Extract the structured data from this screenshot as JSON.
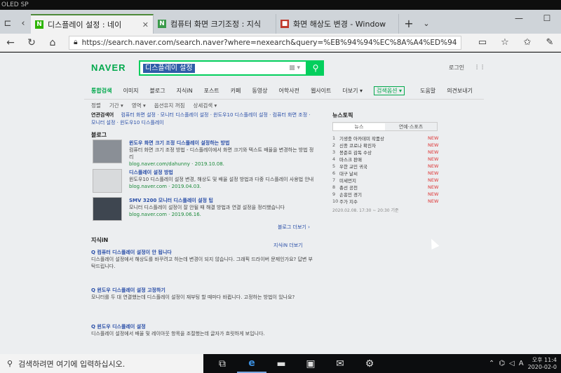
{
  "device_label": "OLED SP",
  "tabs": [
    {
      "title": "디스플레이 설정 : 네이",
      "icon": "N"
    },
    {
      "title": "컴퓨터 화면 크기조정 : 지식",
      "icon": "N"
    },
    {
      "title": "화면 해상도 변경 - Window",
      "icon": "■"
    }
  ],
  "address": "https://search.naver.com/search.naver?where=nexearch&query=%EB%94%94%EC%8A%A4%ED%94",
  "naver": {
    "logo": "NAVER",
    "query": "디스플레이 설정",
    "keyboard": "▩ ▾",
    "header_links": [
      "로그인",
      "⋮⋮"
    ],
    "categories": [
      "통합검색",
      "이미지",
      "블로그",
      "지식iN",
      "포스트",
      "카페",
      "동영상",
      "어학사전",
      "웹사이트",
      "더보기 ▾"
    ],
    "badge": "검색옵션 ▾",
    "right_links": [
      "도움말",
      "의견보내기"
    ],
    "options": [
      "정렬",
      "기간 ▾",
      "영역 ▾",
      "옵션유지 꺼짐",
      "상세검색 ▾"
    ]
  },
  "related": {
    "label": "연관검색어",
    "items": "컴퓨터 화면 설정 · 모니터 디스플레이 설정 · 윈도우10 디스플레이 설정 · 컴퓨터 화면 조정 · 모니터 설정 · 윈도우10 디스플레이"
  },
  "sections": {
    "blog": "블로그",
    "kin": "지식iN"
  },
  "blog_items": [
    {
      "title": "윈도우 화면 크기 조정 디스플레이 설정하는 방법",
      "body": "컴퓨터 화면 크기 조정 방법 - 디스플레이에서 화면 크기와 텍스트 배율을 변경하는 방법 정리",
      "source": "blog.naver.com/dahunny · 2019.10.08."
    },
    {
      "title": "디스플레이 설정 방법",
      "body": "윈도우10 디스플레이 설정 변경, 해상도 및 배율 설정 방법과 다중 디스플레이 사용법 안내",
      "source": "blog.naver.com · 2019.04.03."
    },
    {
      "title": "SMV 3200 모니터 디스플레이 설정 팁",
      "body": "모니터 디스플레이 설정이 잘 안될 때 해결 방법과 연결 설정을 정리했습니다",
      "source": "blog.naver.com · 2019.06.16."
    }
  ],
  "blog_more": "블로그 더보기 ›",
  "kin_more": "지식iN 더보기",
  "kin_items": [
    {
      "title": "Q 컴퓨터 디스플레이 설정이 안 됩니다",
      "body": "디스플레이 설정에서 해상도를 바꾸려고 하는데 변경이 되지 않습니다. 그래픽 드라이버 문제인가요? 답변 부탁드립니다."
    },
    {
      "title": "Q 윈도우 디스플레이 설정 고정하기",
      "body": "모니터를 두 대 연결했는데 디스플레이 설정이 재부팅 할 때마다 바뀝니다. 고정하는 방법이 있나요?"
    },
    {
      "title": "Q 윈도우 디스플레이 설정",
      "body": "디스플레이 설정에서 배율 및 레이아웃 항목을 조절했는데 글자가 흐릿하게 보입니다."
    }
  ],
  "news_box": {
    "title": "뉴스토픽",
    "tabs": [
      "뉴스",
      "연예·스포츠"
    ],
    "items": [
      {
        "n": "1",
        "k": "기생충 아카데미 작품상",
        "s": "NEW"
      },
      {
        "n": "2",
        "k": "신종 코로나 확진자",
        "s": "NEW"
      },
      {
        "n": "3",
        "k": "봉준호 감독 수상",
        "s": "NEW"
      },
      {
        "n": "4",
        "k": "마스크 판매",
        "s": "NEW"
      },
      {
        "n": "5",
        "k": "우한 교민 귀국",
        "s": "NEW"
      },
      {
        "n": "6",
        "k": "대구 날씨",
        "s": "NEW"
      },
      {
        "n": "7",
        "k": "미세먼지",
        "s": "NEW"
      },
      {
        "n": "8",
        "k": "총선 공천",
        "s": "NEW"
      },
      {
        "n": "9",
        "k": "손흥민 경기",
        "s": "NEW"
      },
      {
        "n": "10",
        "k": "주가 지수",
        "s": "NEW"
      }
    ],
    "stamp": "2020.02.08. 17:30 ~ 20:30 기준"
  },
  "taskbar": {
    "search_placeholder": "검색하려면 여기에 입력하십시오.",
    "lang": "A",
    "time": "오후 11:4",
    "date": "2020-02-0"
  }
}
